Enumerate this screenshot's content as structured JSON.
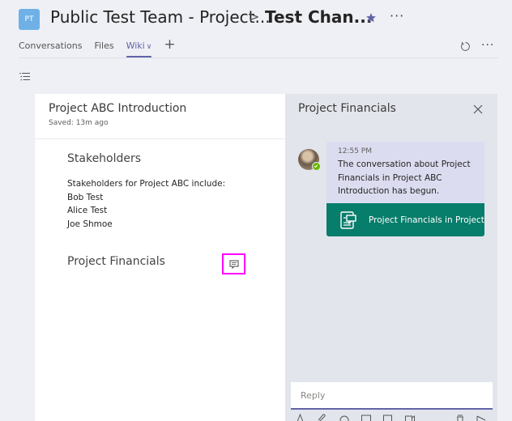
{
  "header": {
    "team_avatar_initials": "PT",
    "team_name": "Public Test Team - Project...",
    "breadcrumb_separator": ">",
    "channel_name": "Test Chan...",
    "more_label": "···",
    "accent_color": "#6264a7"
  },
  "tabs": {
    "items": [
      {
        "label": "Conversations",
        "active": false
      },
      {
        "label": "Files",
        "active": false
      },
      {
        "label": "Wiki",
        "active": true,
        "chevron": "∨"
      }
    ],
    "add_label": "+",
    "more_label": "···"
  },
  "doc": {
    "title": "Project ABC Introduction",
    "saved": "Saved: 13m ago",
    "sections": [
      {
        "heading": "Stakeholders",
        "body": [
          "Stakeholders for Project ABC include:",
          "Bob Test",
          "Alice Test",
          "Joe Shmoe"
        ]
      },
      {
        "heading": "Project Financials",
        "body": []
      }
    ]
  },
  "panel": {
    "title": "Project Financials",
    "message": {
      "time": "12:55 PM",
      "text": "The conversation about Project Financials in Project ABC Introduction has begun.",
      "card_text": "Project Financials in Project ABC Introduction",
      "card_color": "#077d6b",
      "presence": "available"
    },
    "reply_placeholder": "Reply",
    "compose_icons": [
      "format-icon",
      "attach-icon",
      "emoji-icon",
      "gif-icon",
      "sticker-icon",
      "meet-icon",
      "delete-icon",
      "send-icon"
    ]
  }
}
